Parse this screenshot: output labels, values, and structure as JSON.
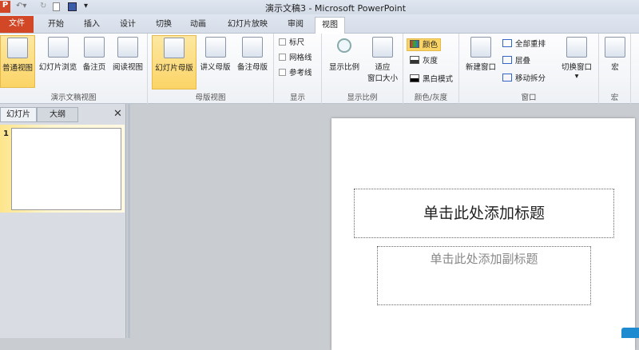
{
  "title": "演示文稿3  -  Microsoft PowerPoint",
  "tabs": [
    "文件",
    "开始",
    "插入",
    "设计",
    "切换",
    "动画",
    "幻灯片放映",
    "审阅",
    "视图"
  ],
  "groups": {
    "presentation_views": {
      "label": "演示文稿视图",
      "items": [
        "普通视图",
        "幻灯片浏览",
        "备注页",
        "阅读视图"
      ]
    },
    "master_views": {
      "label": "母版视图",
      "items": [
        "幻灯片母版",
        "讲义母版",
        "备注母版"
      ]
    },
    "show": {
      "label": "显示",
      "items": [
        "标尺",
        "网格线",
        "参考线"
      ]
    },
    "zoom": {
      "label": "显示比例",
      "items": [
        "显示比例",
        "适应",
        "窗口大小"
      ]
    },
    "color": {
      "label": "颜色/灰度",
      "items": [
        "颜色",
        "灰度",
        "黑白模式"
      ]
    },
    "window": {
      "label": "窗口",
      "items": [
        "新建窗口",
        "全部重排",
        "层叠",
        "移动拆分",
        "切换窗口"
      ]
    },
    "macro": {
      "label": "宏",
      "items": [
        "宏"
      ]
    }
  },
  "panel": {
    "tabs": [
      "幻灯片",
      "大纲"
    ],
    "close": "✕",
    "slide_number": "1"
  },
  "slide": {
    "title_placeholder": "单击此处添加标题",
    "subtitle_placeholder": "单击此处添加副标题"
  }
}
